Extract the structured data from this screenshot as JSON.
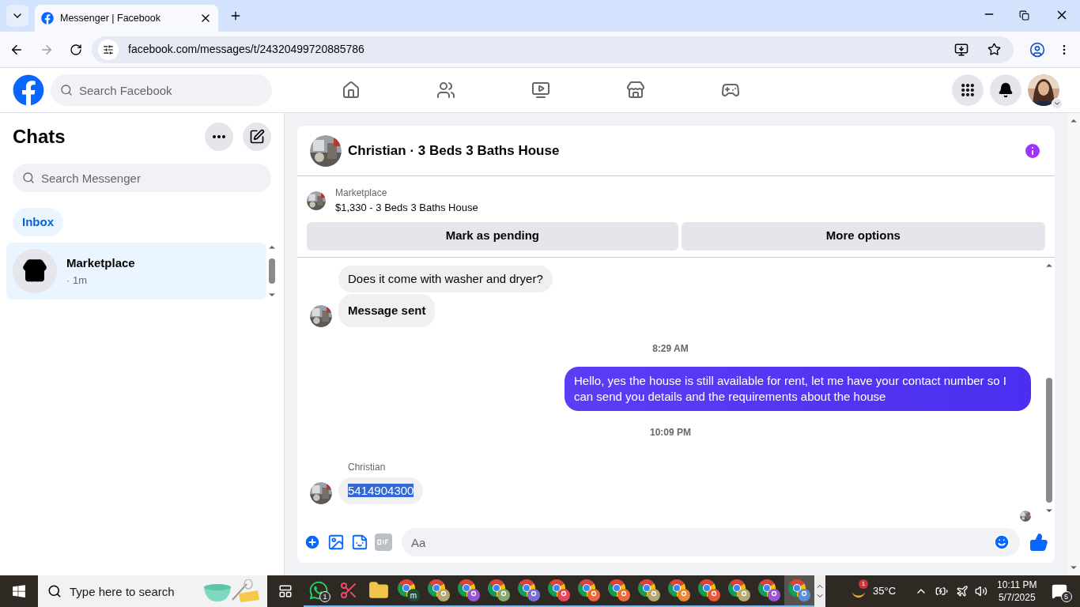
{
  "browser": {
    "tab_title": "Messenger | Facebook",
    "url": "facebook.com/messages/t/24320499720885786"
  },
  "facebook_nav": {
    "search_placeholder": "Search Facebook"
  },
  "sidebar": {
    "title": "Chats",
    "search_placeholder": "Search Messenger",
    "filters": [
      {
        "label": "Inbox",
        "selected": true
      }
    ],
    "chats": [
      {
        "name": "Marketplace",
        "meta": "· 1m",
        "selected": true
      }
    ]
  },
  "conversation": {
    "title": "Christian · 3 Beds 3 Baths House",
    "listing": {
      "source": "Marketplace",
      "title": "$1,330 - 3 Beds 3 Baths House"
    },
    "actions": [
      "Mark as pending",
      "More options"
    ],
    "messages": [
      {
        "kind": "incoming",
        "text": "Does it come with washer and dryer?",
        "avatar": false,
        "bold": false,
        "highlighted": false
      },
      {
        "kind": "incoming",
        "text": "Message sent",
        "avatar": true,
        "bold": true,
        "highlighted": false
      },
      {
        "kind": "time",
        "text": "8:29 AM"
      },
      {
        "kind": "outgoing",
        "text": "Hello, yes the house is still available for rent, let me have your contact number so I can send you details and the requirements about the house"
      },
      {
        "kind": "time",
        "text": "10:09 PM"
      },
      {
        "kind": "sender",
        "text": "Christian"
      },
      {
        "kind": "incoming",
        "text": "5414904300",
        "avatar": true,
        "bold": false,
        "highlighted": true
      }
    ],
    "composer": {
      "placeholder": "Aa"
    }
  },
  "taskbar": {
    "search_placeholder": "Type here to search",
    "apps": [
      {
        "kind": "whatsapp",
        "badge": "1",
        "selected": false
      },
      {
        "kind": "snipping",
        "selected": false
      },
      {
        "kind": "explorer",
        "selected": false
      },
      {
        "kind": "chrome",
        "badge": "m",
        "color": "#1f4d3b",
        "selected": false
      },
      {
        "kind": "chrome",
        "color": "#b3a66f",
        "selected": false
      },
      {
        "kind": "chrome",
        "color": "#9a55d4",
        "selected": false
      },
      {
        "kind": "chrome",
        "color": "#86a86e",
        "selected": false
      },
      {
        "kind": "chrome",
        "color": "#7a6fd8",
        "selected": false
      },
      {
        "kind": "chrome",
        "color": "#e8465a",
        "selected": false
      },
      {
        "kind": "chrome",
        "color": "#e9683b",
        "selected": false
      },
      {
        "kind": "chrome",
        "color": "#ea6a3c",
        "selected": false
      },
      {
        "kind": "chrome",
        "color": "#b3a66f",
        "selected": false
      },
      {
        "kind": "chrome",
        "color": "#e8873a",
        "selected": false
      },
      {
        "kind": "chrome",
        "color": "#e8583a",
        "selected": false
      },
      {
        "kind": "chrome",
        "color": "#b5a872",
        "selected": false
      },
      {
        "kind": "chrome",
        "color": "#9a55d4",
        "selected": false
      },
      {
        "kind": "chrome",
        "color": "#5a8ed8",
        "selected": true
      }
    ],
    "weather": {
      "badge": "1",
      "temperature": "35°C"
    },
    "clock": {
      "time": "10:11 PM",
      "date": "5/7/2025"
    },
    "notifications": "5"
  }
}
